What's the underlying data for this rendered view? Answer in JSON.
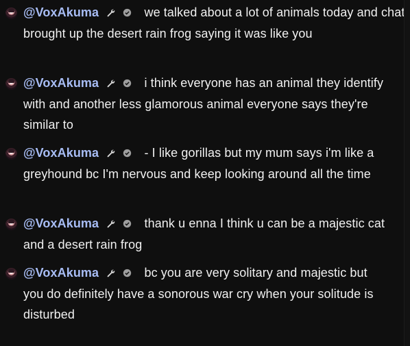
{
  "messages": [
    {
      "author": "@VoxAkuma",
      "text": "we talked about a lot of animals today and chat brought up the desert rain frog saying it was like you"
    },
    {
      "author": "@VoxAkuma",
      "text": "i think everyone has an animal they identify with and another less glamorous animal everyone says they're similar to"
    },
    {
      "author": "@VoxAkuma",
      "text": "- I like gorillas but my mum says i'm like a greyhound bc I'm nervous and keep looking around all the time"
    },
    {
      "author": "@VoxAkuma",
      "text": "thank u enna I think u can be a majestic cat and a desert rain frog"
    },
    {
      "author": "@VoxAkuma",
      "text": "bc you are very solitary and majestic but you do definitely have a sonorous war cry when your solitude is disturbed"
    }
  ]
}
